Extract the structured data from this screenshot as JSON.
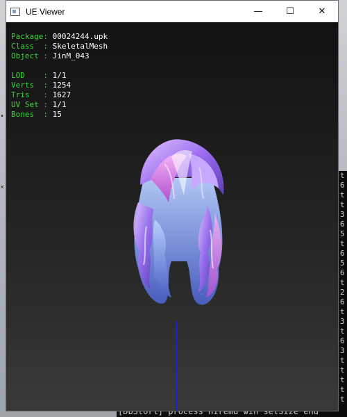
{
  "window": {
    "title": "UE Viewer",
    "controls": {
      "minimize": "—",
      "maximize": "☐",
      "close": "✕"
    }
  },
  "info": {
    "package": {
      "label": "Package: ",
      "value": "00024244.upk"
    },
    "class": {
      "label": "Class  : ",
      "value": "SkeletalMesh"
    },
    "object": {
      "label": "Object : ",
      "value": "JinM_043"
    },
    "lod": {
      "label": "LOD    : ",
      "value": "1/1"
    },
    "verts": {
      "label": "Verts  : ",
      "value": "1254"
    },
    "tris": {
      "label": "Tris   : ",
      "value": "1627"
    },
    "uvset": {
      "label": "UV Set : ",
      "value": "1/1"
    },
    "bones": {
      "label": "Bones  : ",
      "value": "15"
    }
  },
  "console": {
    "bottom_line": "[DbStorl] process  hiremd win setSize  end",
    "side_chars": "t\n6\nt\nt\n3\n6\n5\nt\n6\n5\n6\nt\n2\n6\nt\n3\nt\n6\n3\nt\nt\nt\nt\nt\n5"
  },
  "colors": {
    "label_green": "#36d836",
    "value_white": "#ffffff",
    "axis_blue": "#1f1fd8",
    "hair_purple": "#9b6cf0",
    "hair_pink": "#e07ae6",
    "hair_blue": "#7ea6f0"
  }
}
